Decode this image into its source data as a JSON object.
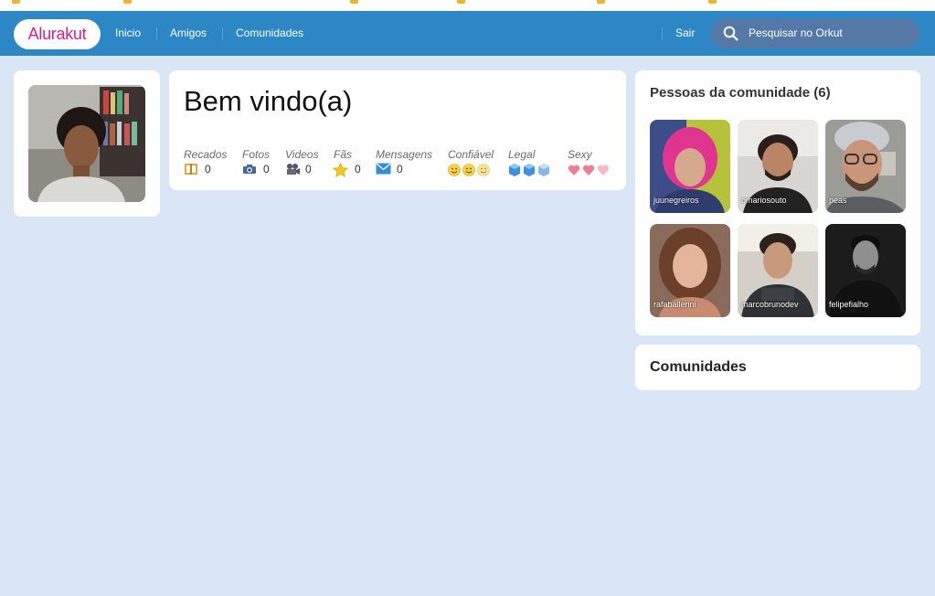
{
  "brand": {
    "logo_text": "Alurakut",
    "accent": "#d81d99",
    "header_bg": "#2e87c5",
    "page_bg": "#d9e6f6"
  },
  "nav": {
    "items": [
      "Inicio",
      "Amigos",
      "Comunidades"
    ],
    "logout": "Sair"
  },
  "search": {
    "placeholder": "Pesquisar no Orkut",
    "icon": "search-icon"
  },
  "welcome": {
    "title": "Bem vindo(a)",
    "stats": [
      {
        "label": "Recados",
        "value": "0",
        "icon": "notebook-icon"
      },
      {
        "label": "Fotos",
        "value": "0",
        "icon": "camera-icon"
      },
      {
        "label": "Videos",
        "value": "0",
        "icon": "video-camera-icon"
      },
      {
        "label": "Fãs",
        "value": "0",
        "icon": "star-icon"
      },
      {
        "label": "Mensagens",
        "value": "0",
        "icon": "envelope-icon"
      },
      {
        "label": "Confiável",
        "rating": 3,
        "icon": "smiley-icon"
      },
      {
        "label": "Legal",
        "rating": 3,
        "icon": "ice-cube-icon"
      },
      {
        "label": "Sexy",
        "rating": 3,
        "icon": "heart-icon"
      }
    ]
  },
  "community_people": {
    "title": "Pessoas da comunidade (6)",
    "people": [
      {
        "name": "juunegreiros"
      },
      {
        "name": "omariosouto"
      },
      {
        "name": "peas"
      },
      {
        "name": "rafaballerini"
      },
      {
        "name": "marcobrunodev"
      },
      {
        "name": "felipefialho"
      }
    ]
  },
  "communities": {
    "title": "Comunidades"
  }
}
